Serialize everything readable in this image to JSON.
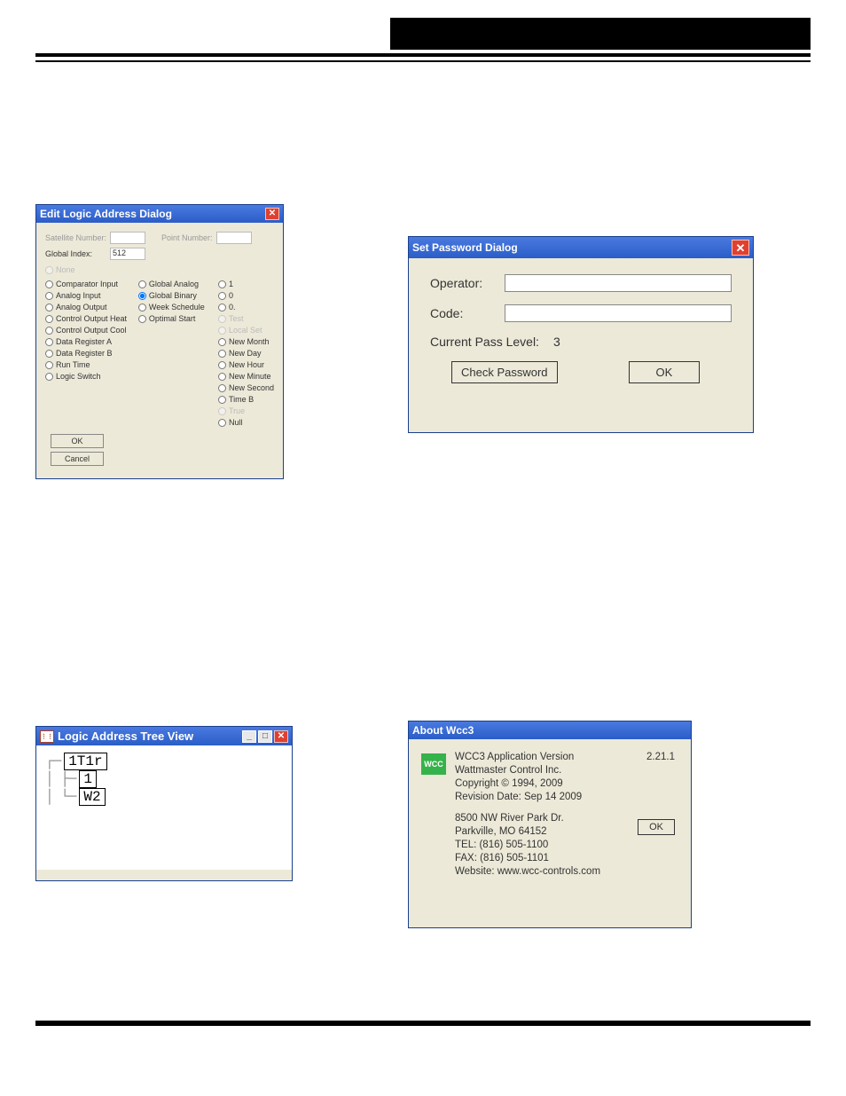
{
  "elad": {
    "title": "Edit Logic Address Dialog",
    "satlabel": "Satellite Number:",
    "ptlabel": "Point Number:",
    "gilabel": "Global Index:",
    "givalue": "512",
    "none_label": "None",
    "col1": [
      "Comparator Input",
      "Analog Input",
      "Analog Output",
      "Control Output Heat",
      "Control Output Cool",
      "Data Register A",
      "Data Register B",
      "Run Time",
      "Logic Switch"
    ],
    "col2": [
      "Global Analog",
      "Global Binary",
      "Week Schedule",
      "Optimal Start"
    ],
    "col3": [
      {
        "t": "1",
        "dim": false
      },
      {
        "t": "0",
        "dim": false
      },
      {
        "t": "0.",
        "dim": false
      },
      {
        "t": "Test",
        "dim": true
      },
      {
        "t": "Local Set",
        "dim": true
      },
      {
        "t": "New Month",
        "dim": false
      },
      {
        "t": "New Day",
        "dim": false
      },
      {
        "t": "New Hour",
        "dim": false
      },
      {
        "t": "New Minute",
        "dim": false
      },
      {
        "t": "New Second",
        "dim": false
      },
      {
        "t": "Time B",
        "dim": false
      },
      {
        "t": "True",
        "dim": true
      },
      {
        "t": "Null",
        "dim": false
      }
    ],
    "ok": "OK",
    "cancel": "Cancel"
  },
  "tree": {
    "title": "Logic Address Tree View",
    "root": "1T1r",
    "child1": "1",
    "child2": "W2"
  },
  "spd": {
    "title": "Set Password Dialog",
    "operator": "Operator:",
    "code": "Code:",
    "cpl_label": "Current Pass Level:",
    "cpl_value": "3",
    "check": "Check Password",
    "ok": "OK"
  },
  "about": {
    "title": "About Wcc3",
    "logo": "WCC",
    "version_label": "WCC3 Application Version",
    "version": "2.21.1",
    "company": "Wattmaster Control Inc.",
    "copyright": "Copyright © 1994, 2009",
    "revision": "Revision Date: Sep 14 2009",
    "addr1": "8500 NW River Park Dr.",
    "addr2": "Parkville, MO 64152",
    "tel": "TEL: (816) 505-1100",
    "fax": "FAX: (816) 505-1101",
    "web": "Website: www.wcc-controls.com",
    "ok": "OK"
  }
}
